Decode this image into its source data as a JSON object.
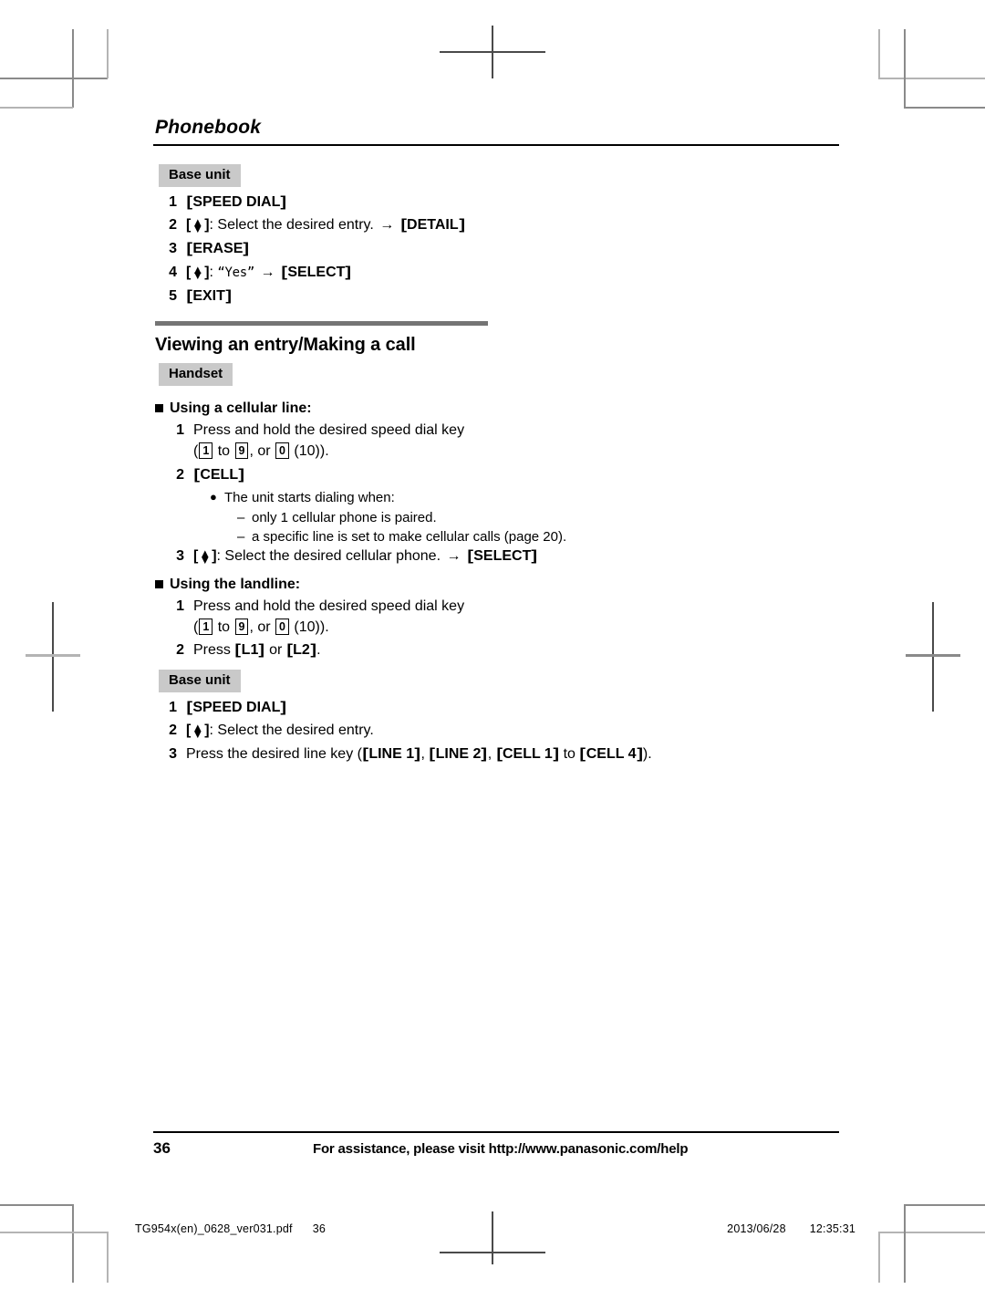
{
  "page": {
    "chapter": "Phonebook",
    "page_number": "36",
    "footer_note": "For assistance, please visit http://www.panasonic.com/help"
  },
  "slug": {
    "filename": "TG954x(en)_0628_ver031.pdf",
    "page": "36",
    "date": "2013/06/28",
    "time": "12:35:31"
  },
  "colors": {
    "tag_background": "#c9c9c9",
    "section_rule": "#747474",
    "crop_mark": "#8a8a8a",
    "text": "#000000"
  },
  "top_block": {
    "device_tag": "Base unit",
    "steps": [
      {
        "num": "1",
        "key": "SPEED DIAL"
      },
      {
        "num": "2",
        "nav": true,
        "text": ": Select the desired entry.",
        "arrow": "→",
        "key2": "DETAIL"
      },
      {
        "num": "3",
        "key": "ERASE"
      },
      {
        "num": "4",
        "nav": true,
        "text": ": ",
        "display": "“Yes”",
        "arrow": "→",
        "key2": "SELECT"
      },
      {
        "num": "5",
        "key": "EXIT"
      }
    ]
  },
  "section": {
    "title": "Viewing an entry/Making a call",
    "device_tag": "Handset",
    "cellular": {
      "heading": "Using a cellular line:",
      "step1": {
        "num": "1",
        "line1": "Press and hold the desired speed dial key",
        "line2_open": "(",
        "dial_from": "1",
        "line2_mid1": " to ",
        "dial_to": "9",
        "line2_mid2": ", or ",
        "dial_zero": "0",
        "line2_close": " (10))."
      },
      "step2": {
        "num": "2",
        "key": "CELL",
        "bullet": "The unit starts dialing when:",
        "dashes": [
          "only 1 cellular phone is paired.",
          "a specific line is set to make cellular calls (page 20)."
        ]
      },
      "step3": {
        "num": "3",
        "text": ": Select the desired cellular phone.",
        "arrow": "→",
        "key": "SELECT"
      }
    },
    "landline": {
      "heading": "Using the landline:",
      "step1": {
        "num": "1",
        "line1": "Press and hold the desired speed dial key",
        "line2_open": "(",
        "dial_from": "1",
        "line2_mid1": " to ",
        "dial_to": "9",
        "line2_mid2": ", or ",
        "dial_zero": "0",
        "line2_close": " (10))."
      },
      "step2": {
        "num": "2",
        "pre": "Press ",
        "key1": "L1",
        "mid": " or ",
        "key2": "L2",
        "post": "."
      }
    },
    "base_unit": {
      "device_tag": "Base unit",
      "step1": {
        "num": "1",
        "key": "SPEED DIAL"
      },
      "step2": {
        "num": "2",
        "text": ": Select the desired entry."
      },
      "step3": {
        "num": "3",
        "pre": "Press the desired line key (",
        "key1": "LINE 1",
        "sep1": ", ",
        "key2": "LINE 2",
        "sep2": ", ",
        "key3": "CELL 1",
        "sep3": " to ",
        "key4": "CELL 4",
        "post": ")."
      }
    }
  }
}
